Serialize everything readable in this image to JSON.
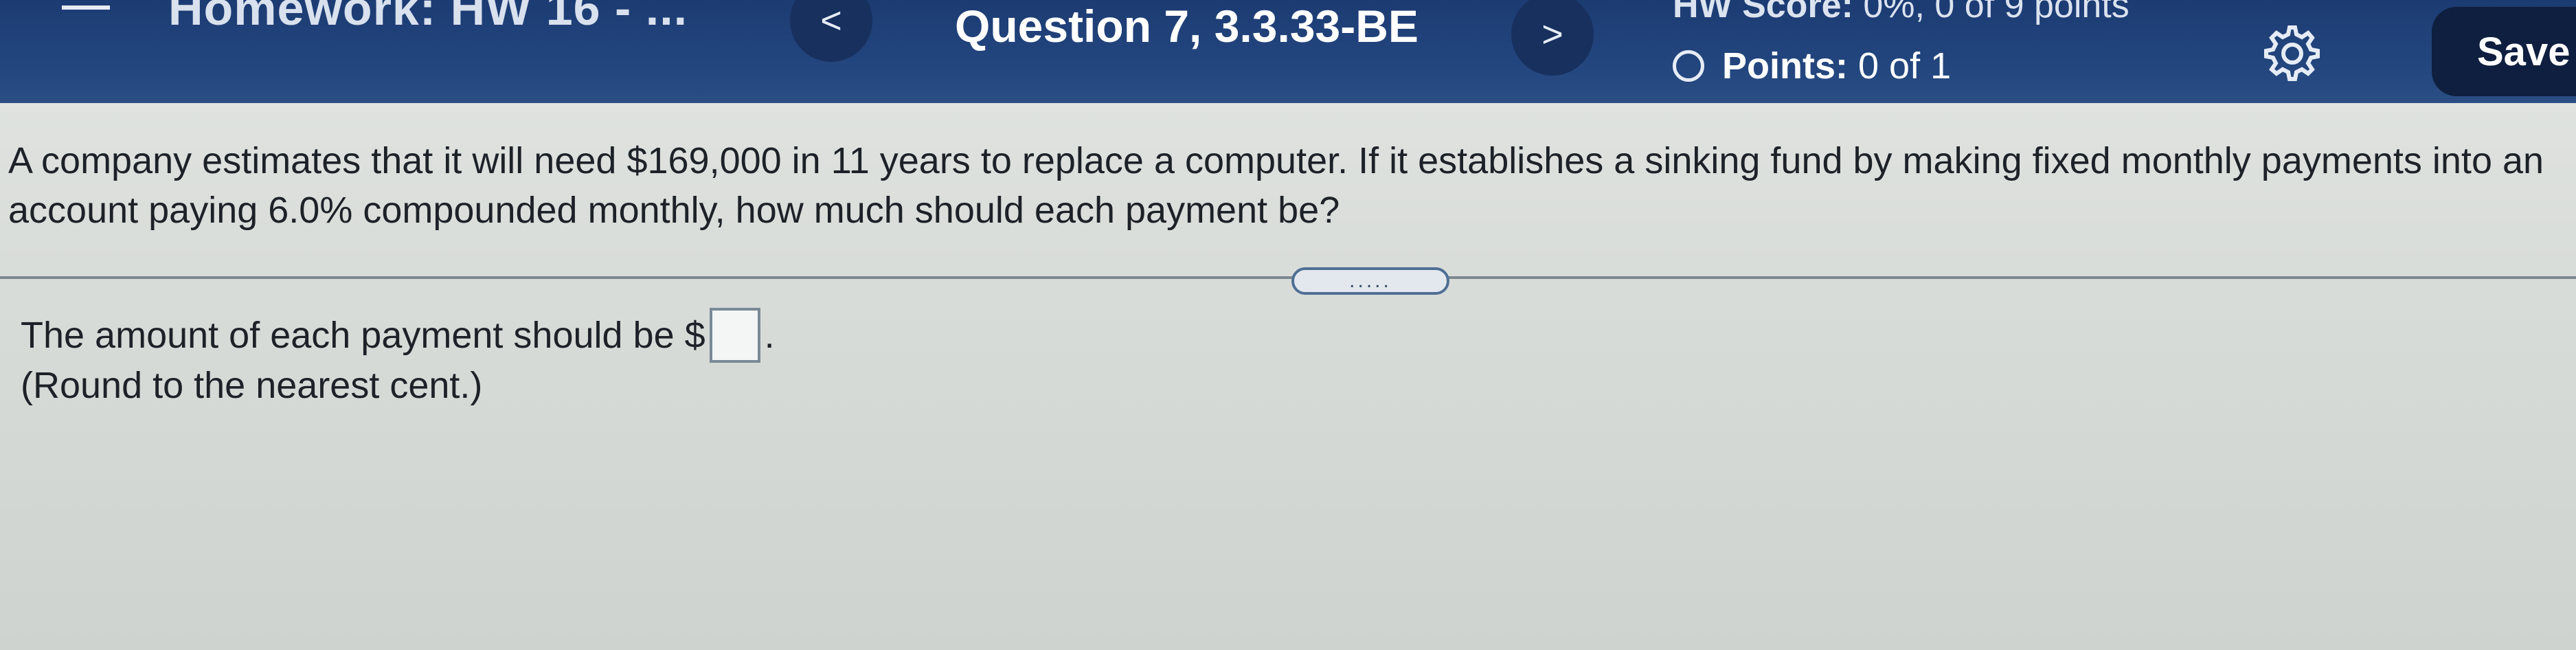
{
  "header": {
    "homework_title": "Homework: HW 16 - ...",
    "prev_label": "<",
    "question_title": "Question 7, 3.3.33-BE",
    "next_label": ">",
    "hw_score_label": "HW Score:",
    "hw_score_value": "0%, 0 of 9 points",
    "points_label": "Points:",
    "points_value": "0 of 1",
    "save_label": "Save"
  },
  "question": {
    "text": "A company estimates that it will need $169,000 in 11 years to replace a computer. If it establishes a sinking fund by making fixed monthly payments into an account paying 6.0% compounded monthly, how much should each payment be?",
    "expand_handle": "....."
  },
  "answer": {
    "prompt_prefix": "The amount of each payment should be $",
    "prompt_suffix": ".",
    "input_value": "",
    "instruction": "(Round to the nearest cent.)"
  },
  "icons": {
    "menu": "hamburger-menu-icon",
    "settings": "gear-icon",
    "points": "circle-outline-icon"
  }
}
